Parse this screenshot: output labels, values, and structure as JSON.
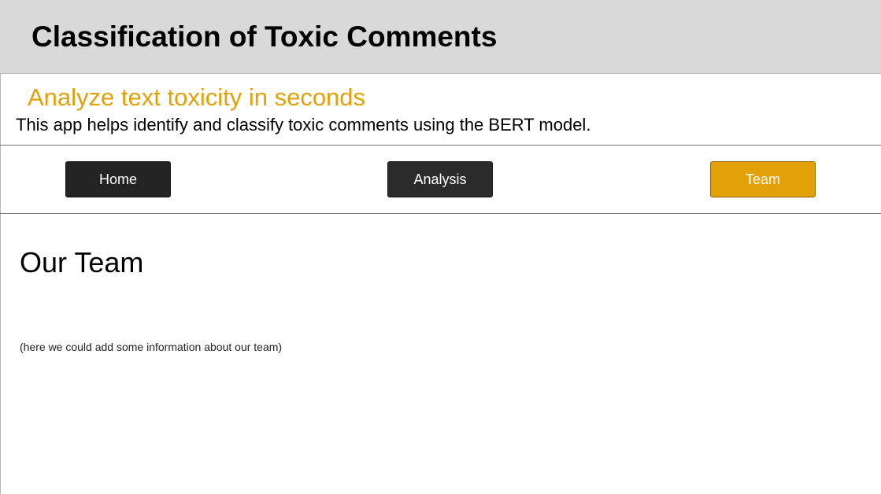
{
  "app": {
    "title": "Classification of Toxic Comments",
    "subtitle": "Analyze text toxicity in seconds",
    "description": "This app helps identify and classify toxic comments using the BERT model."
  },
  "nav": {
    "items": [
      {
        "label": "Home",
        "active": false
      },
      {
        "label": "Analysis",
        "active": false
      },
      {
        "label": "Team",
        "active": true
      }
    ]
  },
  "main": {
    "title": "Our Team",
    "text": "(here we could add some information about our team)"
  },
  "colors": {
    "header_bg": "#d9d9d9",
    "accent": "#e3a109",
    "button_dark": "#232323"
  }
}
